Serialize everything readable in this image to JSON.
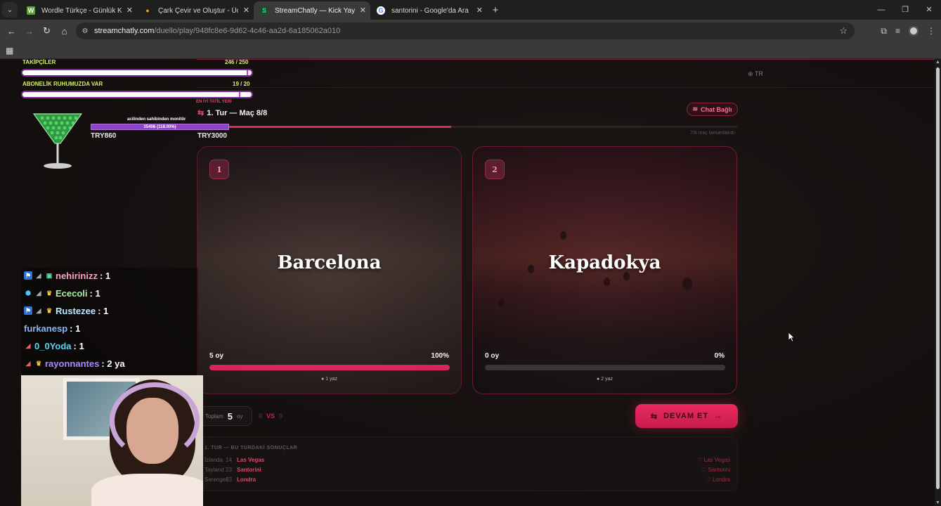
{
  "browser": {
    "tabs": [
      {
        "label": "Wordle Türkçe - Günlük Kelime",
        "favicon": "W",
        "favicon_color": "#5aa13a",
        "active": false
      },
      {
        "label": "Çark Çevir ve Oluştur - Ücretsiz",
        "favicon": "●",
        "favicon_color": "#e0a030",
        "active": false
      },
      {
        "label": "StreamChatly — Kick Yayıncıları",
        "favicon": "S",
        "favicon_color": "#3ddc84",
        "active": true
      },
      {
        "label": "santorini - Google'da Ara",
        "favicon": "G",
        "favicon_color": "#ffffff",
        "active": false
      }
    ],
    "url_host": "streamchatly.com",
    "url_path": "/duello/play/948fc8e6-9d62-4c46-aa2d-6a185062a010"
  },
  "page": {
    "lang": "TR",
    "chat_status": "Chat Bağlı",
    "round_title": "1. Tur — Maç 8/8",
    "match_progress": 0.47,
    "progress_caption": "7/8 maç tamamlandı",
    "cards": [
      {
        "number": "1",
        "name": "Barcelona",
        "votes": "5 oy",
        "percent": "100%",
        "fill": 1.0,
        "comments": "1 yaz"
      },
      {
        "number": "2",
        "name": "Kapadokya",
        "votes": "0 oy",
        "percent": "0%",
        "fill": 0.0,
        "comments": "2 yaz"
      }
    ],
    "total_label": "Toplam",
    "total_value": "5",
    "total_unit": "oy",
    "vs_left": "0",
    "vs_label": "VS",
    "vs_right": "0",
    "continue_label": "DEVAM ET",
    "results_title": "1. TUR — BU TURDAKİ SONUÇLAR",
    "results": [
      {
        "loser": "İzlanda",
        "score": "14",
        "winner": "Las Vegas",
        "right": "Las Vegas"
      },
      {
        "loser": "Tayland",
        "score": "23",
        "winner": "Santorini",
        "right": "Santorini"
      },
      {
        "loser": "Serengeti",
        "score": "23",
        "winner": "Londra",
        "right": "Londra"
      }
    ]
  },
  "overlay": {
    "followers_label": "TAKİPÇİLER",
    "followers_value": "246 / 250",
    "followers_fill": 0.984,
    "subs_label": "ABONELİK RUHUMUZDA VAR",
    "subs_value": "19 / 20",
    "subs_fill": 0.95,
    "best_label": "EN İYİ TATİL YERİ",
    "donate_caption": "acilinden sahibinden monitör",
    "donate_bar": "3540₺ (118.00%)",
    "try_left": "TRY860",
    "try_right": "TRY3000",
    "chat": [
      {
        "user": "nehirinizz",
        "msg": ": 1",
        "color": "#f6a6c8"
      },
      {
        "user": "Ececoli",
        "msg": ": 1",
        "color": "#a8f0a0"
      },
      {
        "user": "Rustezee",
        "msg": ": 1",
        "color": "#bfe8ff"
      },
      {
        "user": "furkanesp",
        "msg": ": 1",
        "color": "#8ab4f8"
      },
      {
        "user": "0_0Yoda",
        "msg": ": 1",
        "color": "#5fd3f3"
      },
      {
        "user": "rayonnantes",
        "msg": ": 2 ya",
        "color": "#a78bfa"
      }
    ]
  }
}
